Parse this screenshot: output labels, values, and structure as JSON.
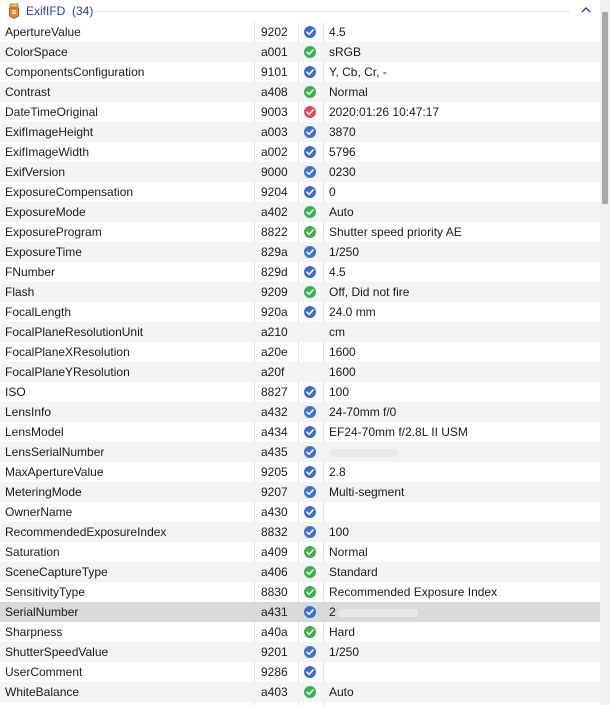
{
  "group": {
    "title": "ExifIFD",
    "count": "(34)",
    "icon": "tag-icon",
    "collapse_icon": "chevron-up-icon"
  },
  "colors": {
    "blue_check": "#3b6fd6",
    "green_check": "#36b24a",
    "red_check": "#e8495a",
    "selected_row": "#d9d9d9"
  },
  "rows": [
    {
      "name": "ApertureValue",
      "id": "9202",
      "status": "blue",
      "value": "4.5"
    },
    {
      "name": "ColorSpace",
      "id": "a001",
      "status": "green",
      "value": "sRGB"
    },
    {
      "name": "ComponentsConfiguration",
      "id": "9101",
      "status": "blue",
      "value": "Y, Cb, Cr, -"
    },
    {
      "name": "Contrast",
      "id": "a408",
      "status": "green",
      "value": "Normal"
    },
    {
      "name": "DateTimeOriginal",
      "id": "9003",
      "status": "red",
      "value": "2020:01:26 10:47:17"
    },
    {
      "name": "ExifImageHeight",
      "id": "a003",
      "status": "blue",
      "value": "3870"
    },
    {
      "name": "ExifImageWidth",
      "id": "a002",
      "status": "blue",
      "value": "5796"
    },
    {
      "name": "ExifVersion",
      "id": "9000",
      "status": "blue",
      "value": "0230"
    },
    {
      "name": "ExposureCompensation",
      "id": "9204",
      "status": "blue",
      "value": "0"
    },
    {
      "name": "ExposureMode",
      "id": "a402",
      "status": "green",
      "value": "Auto"
    },
    {
      "name": "ExposureProgram",
      "id": "8822",
      "status": "green",
      "value": "Shutter speed priority AE"
    },
    {
      "name": "ExposureTime",
      "id": "829a",
      "status": "blue",
      "value": "1/250"
    },
    {
      "name": "FNumber",
      "id": "829d",
      "status": "blue",
      "value": "4.5"
    },
    {
      "name": "Flash",
      "id": "9209",
      "status": "green",
      "value": "Off, Did not fire"
    },
    {
      "name": "FocalLength",
      "id": "920a",
      "status": "blue",
      "value": "24.0 mm"
    },
    {
      "name": "FocalPlaneResolutionUnit",
      "id": "a210",
      "status": "",
      "value": "cm"
    },
    {
      "name": "FocalPlaneXResolution",
      "id": "a20e",
      "status": "",
      "value": "1600"
    },
    {
      "name": "FocalPlaneYResolution",
      "id": "a20f",
      "status": "",
      "value": "1600"
    },
    {
      "name": "ISO",
      "id": "8827",
      "status": "blue",
      "value": "100"
    },
    {
      "name": "LensInfo",
      "id": "a432",
      "status": "blue",
      "value": "24-70mm f/0"
    },
    {
      "name": "LensModel",
      "id": "a434",
      "status": "blue",
      "value": "EF24-70mm f/2.8L II USM"
    },
    {
      "name": "LensSerialNumber",
      "id": "a435",
      "status": "blue",
      "value": "",
      "redacted": true
    },
    {
      "name": "MaxApertureValue",
      "id": "9205",
      "status": "blue",
      "value": "2.8"
    },
    {
      "name": "MeteringMode",
      "id": "9207",
      "status": "blue",
      "value": "Multi-segment"
    },
    {
      "name": "OwnerName",
      "id": "a430",
      "status": "blue",
      "value": ""
    },
    {
      "name": "RecommendedExposureIndex",
      "id": "8832",
      "status": "blue",
      "value": "100"
    },
    {
      "name": "Saturation",
      "id": "a409",
      "status": "green",
      "value": "Normal"
    },
    {
      "name": "SceneCaptureType",
      "id": "a406",
      "status": "green",
      "value": "Standard"
    },
    {
      "name": "SensitivityType",
      "id": "8830",
      "status": "green",
      "value": "Recommended Exposure Index"
    },
    {
      "name": "SerialNumber",
      "id": "a431",
      "status": "blue",
      "value": "2",
      "redacted": true,
      "selected": true
    },
    {
      "name": "Sharpness",
      "id": "a40a",
      "status": "green",
      "value": "Hard"
    },
    {
      "name": "ShutterSpeedValue",
      "id": "9201",
      "status": "blue",
      "value": "1/250"
    },
    {
      "name": "UserComment",
      "id": "9286",
      "status": "blue",
      "value": ""
    },
    {
      "name": "WhiteBalance",
      "id": "a403",
      "status": "green",
      "value": "Auto"
    }
  ]
}
